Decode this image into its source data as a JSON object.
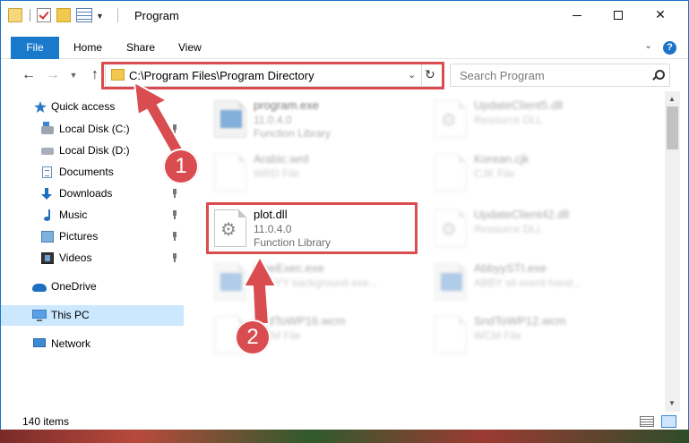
{
  "window": {
    "title": "Program",
    "controls": {
      "minimize": "minimize",
      "maximize": "maximize",
      "close": "✕"
    }
  },
  "ribbon": {
    "tabs": [
      "File",
      "Home",
      "Share",
      "View"
    ],
    "help": "?"
  },
  "nav": {
    "address": "C:\\Program Files\\Program Directory",
    "search_placeholder": "Search Program"
  },
  "sidebar": {
    "items": [
      {
        "label": "Quick access",
        "icon": "star-icon"
      },
      {
        "label": "Local Disk (C:)",
        "icon": "drive-icon",
        "pinned": true
      },
      {
        "label": "Local Disk (D:)",
        "icon": "drive-icon"
      },
      {
        "label": "Documents",
        "icon": "documents-icon",
        "pinned": true
      },
      {
        "label": "Downloads",
        "icon": "downloads-icon",
        "pinned": true
      },
      {
        "label": "Music",
        "icon": "music-icon",
        "pinned": true
      },
      {
        "label": "Pictures",
        "icon": "pictures-icon",
        "pinned": true
      },
      {
        "label": "Videos",
        "icon": "videos-icon",
        "pinned": true
      },
      {
        "label": "OneDrive",
        "icon": "onedrive-icon"
      },
      {
        "label": "This PC",
        "icon": "computer-icon",
        "selected": true
      },
      {
        "label": "Network",
        "icon": "network-icon"
      }
    ]
  },
  "files": [
    {
      "name": "program.exe",
      "version": "11.0.4.0",
      "type": "Function Library"
    },
    {
      "name": "UpdateClient5.dll",
      "type": "Resource DLL"
    },
    {
      "name": "Arabic.wrd",
      "type": "WRD File"
    },
    {
      "name": "Korean.cjk",
      "type": "CJK File"
    },
    {
      "name": "plot.dll",
      "version": "11.0.4.0",
      "type": "Function Library"
    },
    {
      "name": "UpdateClient42.dll",
      "type": "Resource DLL"
    },
    {
      "name": "FineExec.exe",
      "type": "ABBYY background exe..."
    },
    {
      "name": "AbbyySTI.exe",
      "type": "ABBY sti event hand..."
    },
    {
      "name": "SndToWP16.wcm",
      "type": "WCM File"
    },
    {
      "name": "SndToWP12.wcm",
      "type": "WCM File"
    }
  ],
  "status": {
    "item_count": "140 items"
  },
  "annotations": {
    "step1": "1",
    "step2": "2",
    "color": "#d94c4f"
  },
  "colors": {
    "accent": "#1979ca",
    "selected": "#cce8ff"
  }
}
